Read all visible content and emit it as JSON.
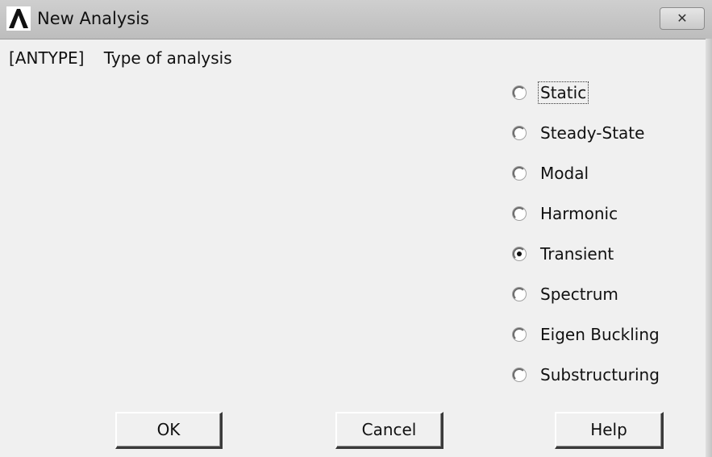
{
  "window": {
    "title": "New Analysis",
    "close_glyph": "✕"
  },
  "prompt": {
    "command": "[ANTYPE]",
    "label": "Type of analysis"
  },
  "analysis_types": [
    {
      "label": "Static",
      "checked": false,
      "focused": true
    },
    {
      "label": "Steady-State",
      "checked": false,
      "focused": false
    },
    {
      "label": "Modal",
      "checked": false,
      "focused": false
    },
    {
      "label": "Harmonic",
      "checked": false,
      "focused": false
    },
    {
      "label": "Transient",
      "checked": true,
      "focused": false
    },
    {
      "label": "Spectrum",
      "checked": false,
      "focused": false
    },
    {
      "label": "Eigen Buckling",
      "checked": false,
      "focused": false
    },
    {
      "label": "Substructuring",
      "checked": false,
      "focused": false
    }
  ],
  "buttons": {
    "ok": "OK",
    "cancel": "Cancel",
    "help": "Help"
  },
  "icons": {
    "app": "ansys-logo-icon",
    "close": "close-icon"
  }
}
